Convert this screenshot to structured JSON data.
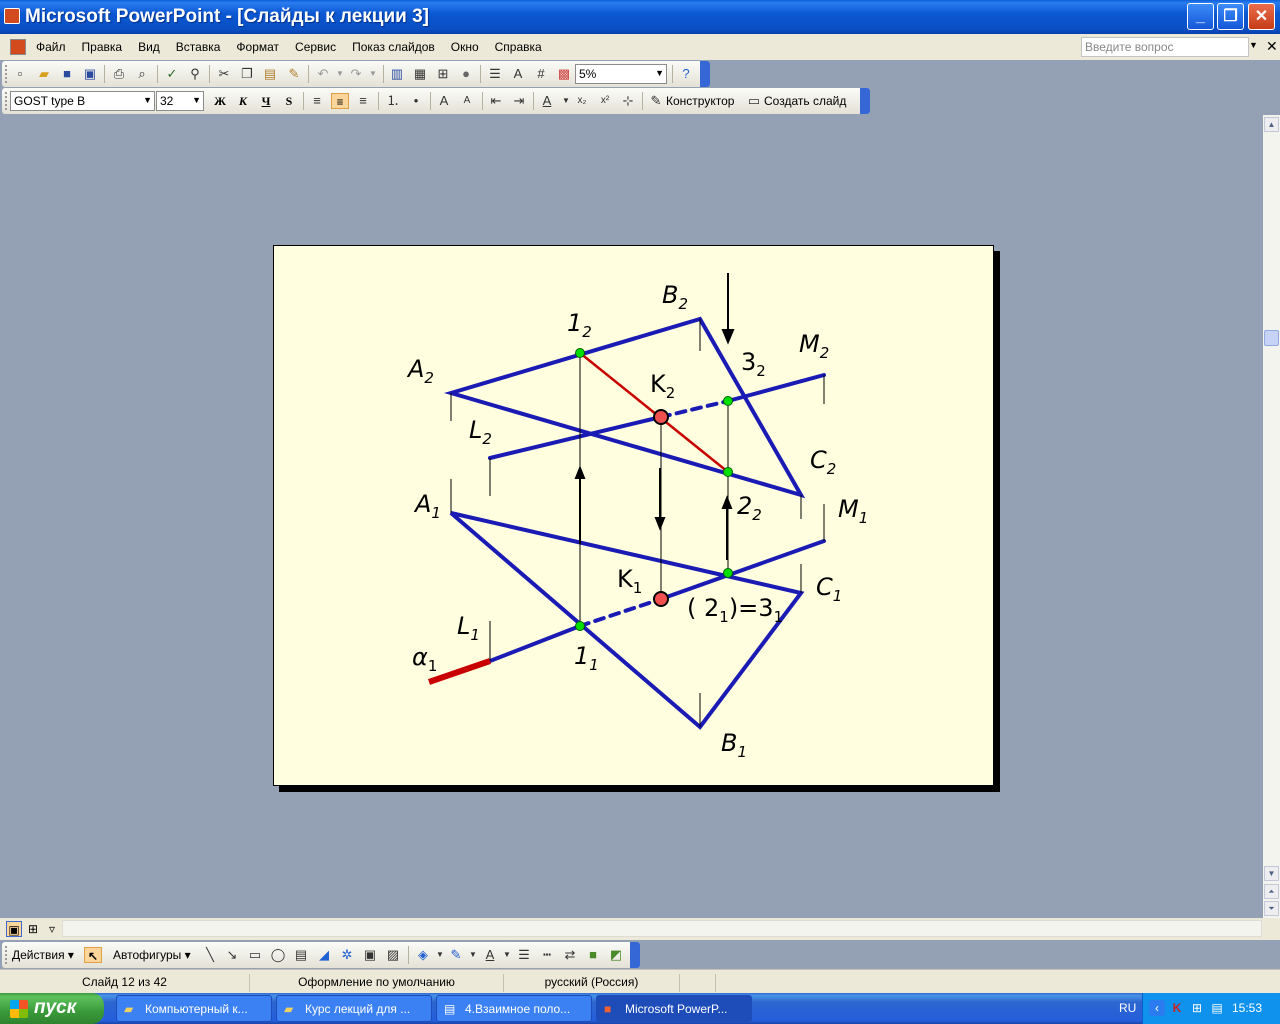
{
  "window": {
    "title": "Microsoft PowerPoint - [Слайды к лекции 3]",
    "min_glyph": "_",
    "max_glyph": "❐",
    "close_glyph": "✕"
  },
  "menu": {
    "items": [
      "Файл",
      "Правка",
      "Вид",
      "Вставка",
      "Формат",
      "Сервис",
      "Показ слайдов",
      "Окно",
      "Справка"
    ],
    "help_placeholder": "Введите вопрос"
  },
  "standard_toolbar": {
    "zoom": "5%"
  },
  "format_toolbar": {
    "font": "GOST type B",
    "size": "32",
    "bold": "Ж",
    "italic": "К",
    "underline": "Ч",
    "shadow": "S",
    "designer": "Конструктор",
    "new_slide": "Создать слайд"
  },
  "drawing_toolbar": {
    "actions": "Действия",
    "autoshapes": "Автофигуры"
  },
  "status": {
    "slide": "Слайд 12 из 42",
    "design": "Оформление по умолчанию",
    "language": "русский (Россия)"
  },
  "taskbar": {
    "start": "пуск",
    "tasks": [
      "Компьютерный к...",
      "Курс лекций для ...",
      "4.Взаимное поло...",
      "Microsoft PowerP..."
    ],
    "lang": "RU",
    "clock": "15:53"
  },
  "slide": {
    "labels": {
      "B2": [
        "B",
        "2"
      ],
      "one2": [
        "1",
        "2"
      ],
      "three2": [
        "3",
        "2"
      ],
      "M2": [
        "M",
        "2"
      ],
      "A2": [
        "A",
        "2"
      ],
      "K2": [
        "K",
        "2"
      ],
      "L2": [
        "L",
        "2"
      ],
      "C2": [
        "C",
        "2"
      ],
      "A1": [
        "A",
        "1"
      ],
      "two2": [
        "2",
        "2"
      ],
      "M1": [
        "M",
        "1"
      ],
      "K1": [
        "K",
        "1"
      ],
      "C1": [
        "C",
        "1"
      ],
      "L1": [
        "L",
        "1"
      ],
      "alpha1": [
        "α",
        "1"
      ],
      "one1": [
        "1",
        "1"
      ],
      "B1": [
        "B",
        "1"
      ]
    },
    "label_21_31": {
      "open": "( 2",
      "sub1": "1",
      "mid": ")=3",
      "sub2": "1"
    },
    "colors": {
      "lines": "#1a1ab4",
      "red": "#c80000",
      "point_green": "#00e000",
      "point_red": "#f05050"
    }
  }
}
